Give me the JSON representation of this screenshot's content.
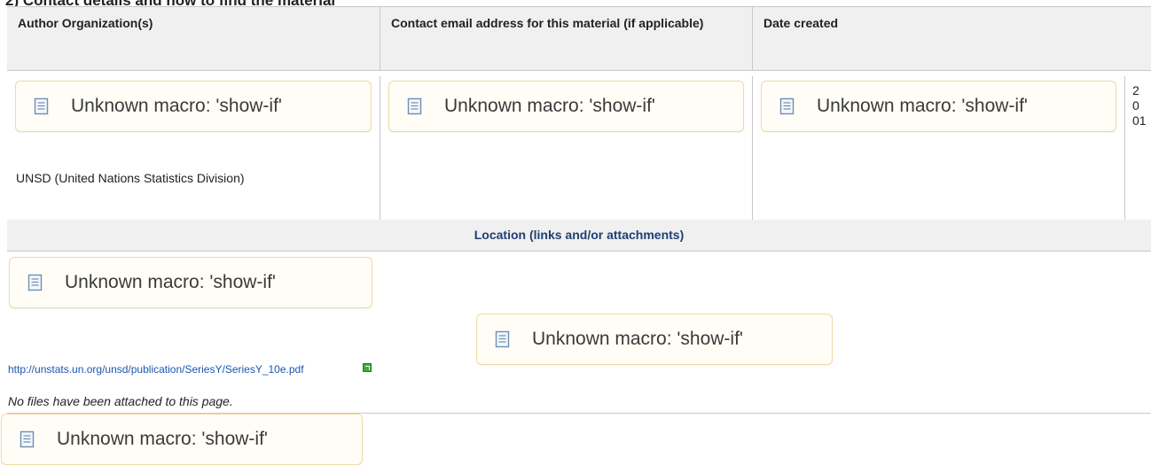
{
  "section": {
    "heading": "2) Contact details and how to find the material"
  },
  "table": {
    "headers": [
      "Author Organization(s)",
      "Contact email address for this material (if applicable)",
      "Date created"
    ],
    "macro_text": "Unknown macro: 'show-if'",
    "author_org": "UNSD (United Nations Statistics Division)",
    "date_fragment": [
      "2",
      "0",
      "01"
    ],
    "location_header": "Location (links and/or attachments)",
    "link_text": "http://unstats.un.org/unsd/publication/SeriesY/SeriesY_10e.pdf",
    "attachments_note": "No files have been attached to this page."
  },
  "icons": {
    "macro": "macro-scroll-icon",
    "external_link": "external-link-icon"
  },
  "colors": {
    "link": "#1a56b0",
    "location_header": "#1f3f73",
    "macro_border": "#f0d9a6"
  }
}
